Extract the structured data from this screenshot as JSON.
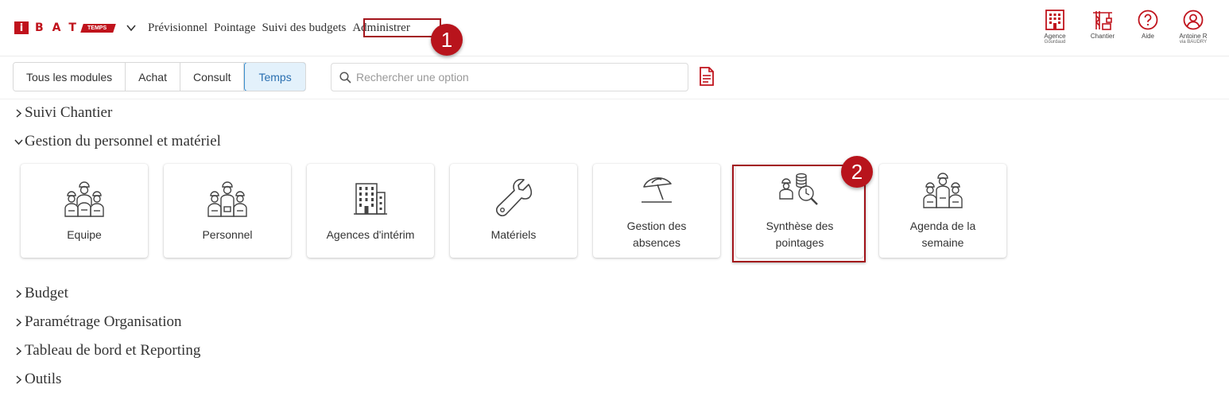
{
  "header": {
    "logo": {
      "letter": "i",
      "brand": "BAT",
      "tag": "TEMPS"
    },
    "nav": [
      "Prévisionnel",
      "Pointage",
      "Suivi des budgets",
      "Administrer"
    ],
    "tools": [
      {
        "label": "Agence",
        "sub": "Gourdaud",
        "icon": "building-icon"
      },
      {
        "label": "Chantier",
        "sub": "",
        "icon": "crane-icon"
      },
      {
        "label": "Aide",
        "sub": "",
        "icon": "help-icon"
      },
      {
        "label": "Antoine R",
        "sub": "via BAUDRY",
        "icon": "user-icon"
      }
    ],
    "accent_color": "#c0131c"
  },
  "annotations": {
    "step1": "1",
    "step2": "2"
  },
  "toolbar": {
    "modules": [
      "Tous les modules",
      "Achat",
      "Consult",
      "Temps"
    ],
    "active_module": "Temps",
    "search_placeholder": "Rechercher une option"
  },
  "sections": [
    {
      "title": "Suivi Chantier",
      "expanded": false
    },
    {
      "title": "Gestion du personnel et matériel",
      "expanded": true
    },
    {
      "title": "Budget",
      "expanded": false
    },
    {
      "title": "Paramétrage Organisation",
      "expanded": false
    },
    {
      "title": "Tableau de bord et Reporting",
      "expanded": false
    },
    {
      "title": "Outils",
      "expanded": false
    }
  ],
  "cards": [
    {
      "label": "Equipe",
      "icon": "team-icon"
    },
    {
      "label": "Personnel",
      "icon": "workers-icon"
    },
    {
      "label": "Agences d'intérim",
      "icon": "office-building-icon"
    },
    {
      "label": "Matériels",
      "icon": "wrench-icon"
    },
    {
      "label": "Gestion des\nabsences",
      "icon": "beach-umbrella-icon"
    },
    {
      "label": "Synthèse des\npointages",
      "icon": "time-summary-icon"
    },
    {
      "label": "Agenda de la\nsemaine",
      "icon": "workers-group-icon"
    }
  ]
}
